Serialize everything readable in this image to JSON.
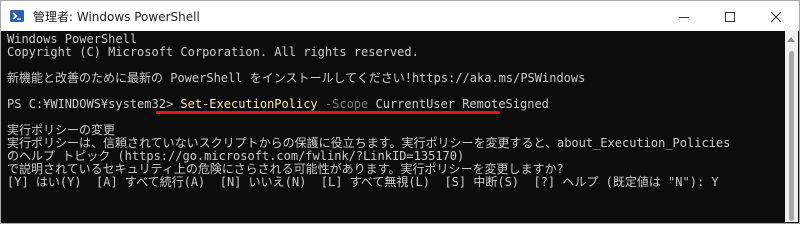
{
  "window": {
    "title": "管理者: Windows PowerShell"
  },
  "terminal": {
    "header_line1": "Windows PowerShell",
    "header_line2": "Copyright (C) Microsoft Corporation. All rights reserved.",
    "install_message": "新機能と改善のために最新の PowerShell をインストールしてください!https://aka.ms/PSWindows",
    "prompt": "PS C:¥WINDOWS¥system32> ",
    "command": {
      "cmdlet": "Set-ExecutionPolicy",
      "param": "-Scope",
      "args": "CurrentUser RemoteSigned"
    },
    "policy_title": "実行ポリシーの変更",
    "policy_line1": "実行ポリシーは、信頼されていないスクリプトからの保護に役立ちます。実行ポリシーを変更すると、about_Execution_Policies",
    "policy_line2": "のヘルプ トピック (https://go.microsoft.com/fwlink/?LinkID=135170)",
    "policy_line3": "で説明されているセキュリティ上の危険にさらされる可能性があります。実行ポリシーを変更しますか?",
    "choices_line": "[Y] はい(Y)  [A] すべて続行(A)  [N] いいえ(N)  [L] すべて無視(L)  [S] 中断(S)  [?] ヘルプ (既定値は \"N\"): Y"
  },
  "colors": {
    "console_bg": "#0c0c0c",
    "console_fg": "#cccccc",
    "cmdlet": "#f9f1a5",
    "parameter": "#767676",
    "highlight_underline": "#e81123"
  },
  "icons": {
    "app": "powershell-icon",
    "minimize": "minimize-icon",
    "maximize": "maximize-icon",
    "close": "close-icon"
  }
}
